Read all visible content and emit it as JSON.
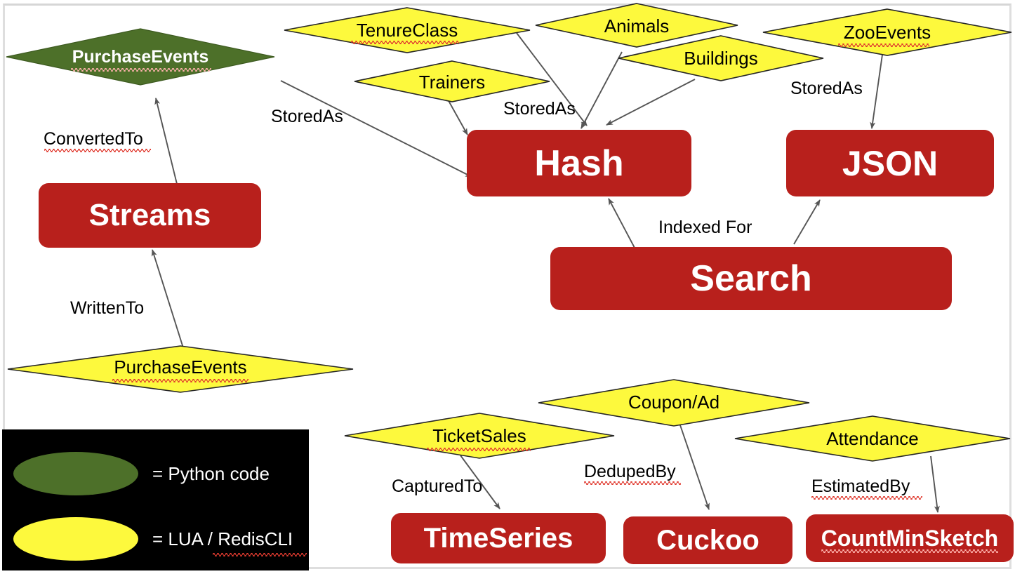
{
  "legend": {
    "items": [
      {
        "shape": "ellipse",
        "color": "#4d7029",
        "label": "= Python code",
        "misspelled": false
      },
      {
        "shape": "ellipse",
        "color": "#fdf93d",
        "label": "= LUA / RedisCLI",
        "misspelled": true
      }
    ]
  },
  "colors": {
    "redis_red": "#b8201c",
    "python_green": "#4d7029",
    "lua_yellow": "#fdf93d",
    "edge_gray": "#555555",
    "frame_gray": "#dedede",
    "legend_bg": "#000000",
    "spell_underline": "#e03a2f"
  },
  "nodes": {
    "boxes": [
      {
        "id": "streams",
        "label": "Streams",
        "type": "datastructure"
      },
      {
        "id": "hash",
        "label": "Hash",
        "type": "datastructure"
      },
      {
        "id": "json",
        "label": "JSON",
        "type": "datastructure"
      },
      {
        "id": "search",
        "label": "Search",
        "type": "datastructure"
      },
      {
        "id": "timeseries",
        "label": "TimeSeries",
        "type": "datastructure"
      },
      {
        "id": "cuckoo",
        "label": "Cuckoo",
        "type": "datastructure"
      },
      {
        "id": "countminsketch",
        "label": "CountMinSketch",
        "type": "datastructure"
      }
    ],
    "diamonds": [
      {
        "id": "purchaseevents-py",
        "label": "PurchaseEvents",
        "kind": "python",
        "misspelled": true
      },
      {
        "id": "tenureclass",
        "label": "TenureClass",
        "kind": "lua",
        "misspelled": true
      },
      {
        "id": "animals",
        "label": "Animals",
        "kind": "lua",
        "misspelled": false
      },
      {
        "id": "zooevents",
        "label": "ZooEvents",
        "kind": "lua",
        "misspelled": true
      },
      {
        "id": "buildings",
        "label": "Buildings",
        "kind": "lua",
        "misspelled": false
      },
      {
        "id": "trainers",
        "label": "Trainers",
        "kind": "lua",
        "misspelled": false
      },
      {
        "id": "purchaseevents-lua",
        "label": "PurchaseEvents",
        "kind": "lua",
        "misspelled": true
      },
      {
        "id": "couponad",
        "label": "Coupon/Ad",
        "kind": "lua",
        "misspelled": false
      },
      {
        "id": "ticketsales",
        "label": "TicketSales",
        "kind": "lua",
        "misspelled": true
      },
      {
        "id": "attendance",
        "label": "Attendance",
        "kind": "lua",
        "misspelled": false
      }
    ]
  },
  "edges": [
    {
      "id": "e-convertedto",
      "label": "ConvertedTo",
      "from": "streams",
      "to": "purchaseevents-py",
      "misspelled": true
    },
    {
      "id": "e-writtento",
      "label": "WrittenTo",
      "from": "purchaseevents-lua",
      "to": "streams",
      "misspelled": false
    },
    {
      "id": "e-storedas-1",
      "label": "StoredAs",
      "from": "purchaseevents-py",
      "to": "hash",
      "misspelled": false
    },
    {
      "id": "e-storedas-2",
      "label": "StoredAs",
      "from": "trainers",
      "to": "hash",
      "misspelled": false
    },
    {
      "id": "e-storedas-3",
      "label": "StoredAs",
      "from": "tenureclass",
      "to": "hash",
      "misspelled": false
    },
    {
      "id": "e-animals",
      "label": "",
      "from": "animals",
      "to": "hash",
      "misspelled": false
    },
    {
      "id": "e-buildings",
      "label": "",
      "from": "buildings",
      "to": "hash",
      "misspelled": false
    },
    {
      "id": "e-storedas-4",
      "label": "StoredAs",
      "from": "zooevents",
      "to": "json",
      "misspelled": false
    },
    {
      "id": "e-indexedfor-h",
      "label": "Indexed For",
      "from": "search",
      "to": "hash",
      "misspelled": false
    },
    {
      "id": "e-indexedfor-j",
      "label": "",
      "from": "search",
      "to": "json",
      "misspelled": false
    },
    {
      "id": "e-capturedto",
      "label": "CapturedTo",
      "from": "ticketsales",
      "to": "timeseries",
      "misspelled": false
    },
    {
      "id": "e-dedupedby",
      "label": "DedupedBy",
      "from": "couponad",
      "to": "cuckoo",
      "misspelled": true
    },
    {
      "id": "e-estimatedby",
      "label": "EstimatedBy",
      "from": "attendance",
      "to": "countminsketch",
      "misspelled": true
    }
  ]
}
